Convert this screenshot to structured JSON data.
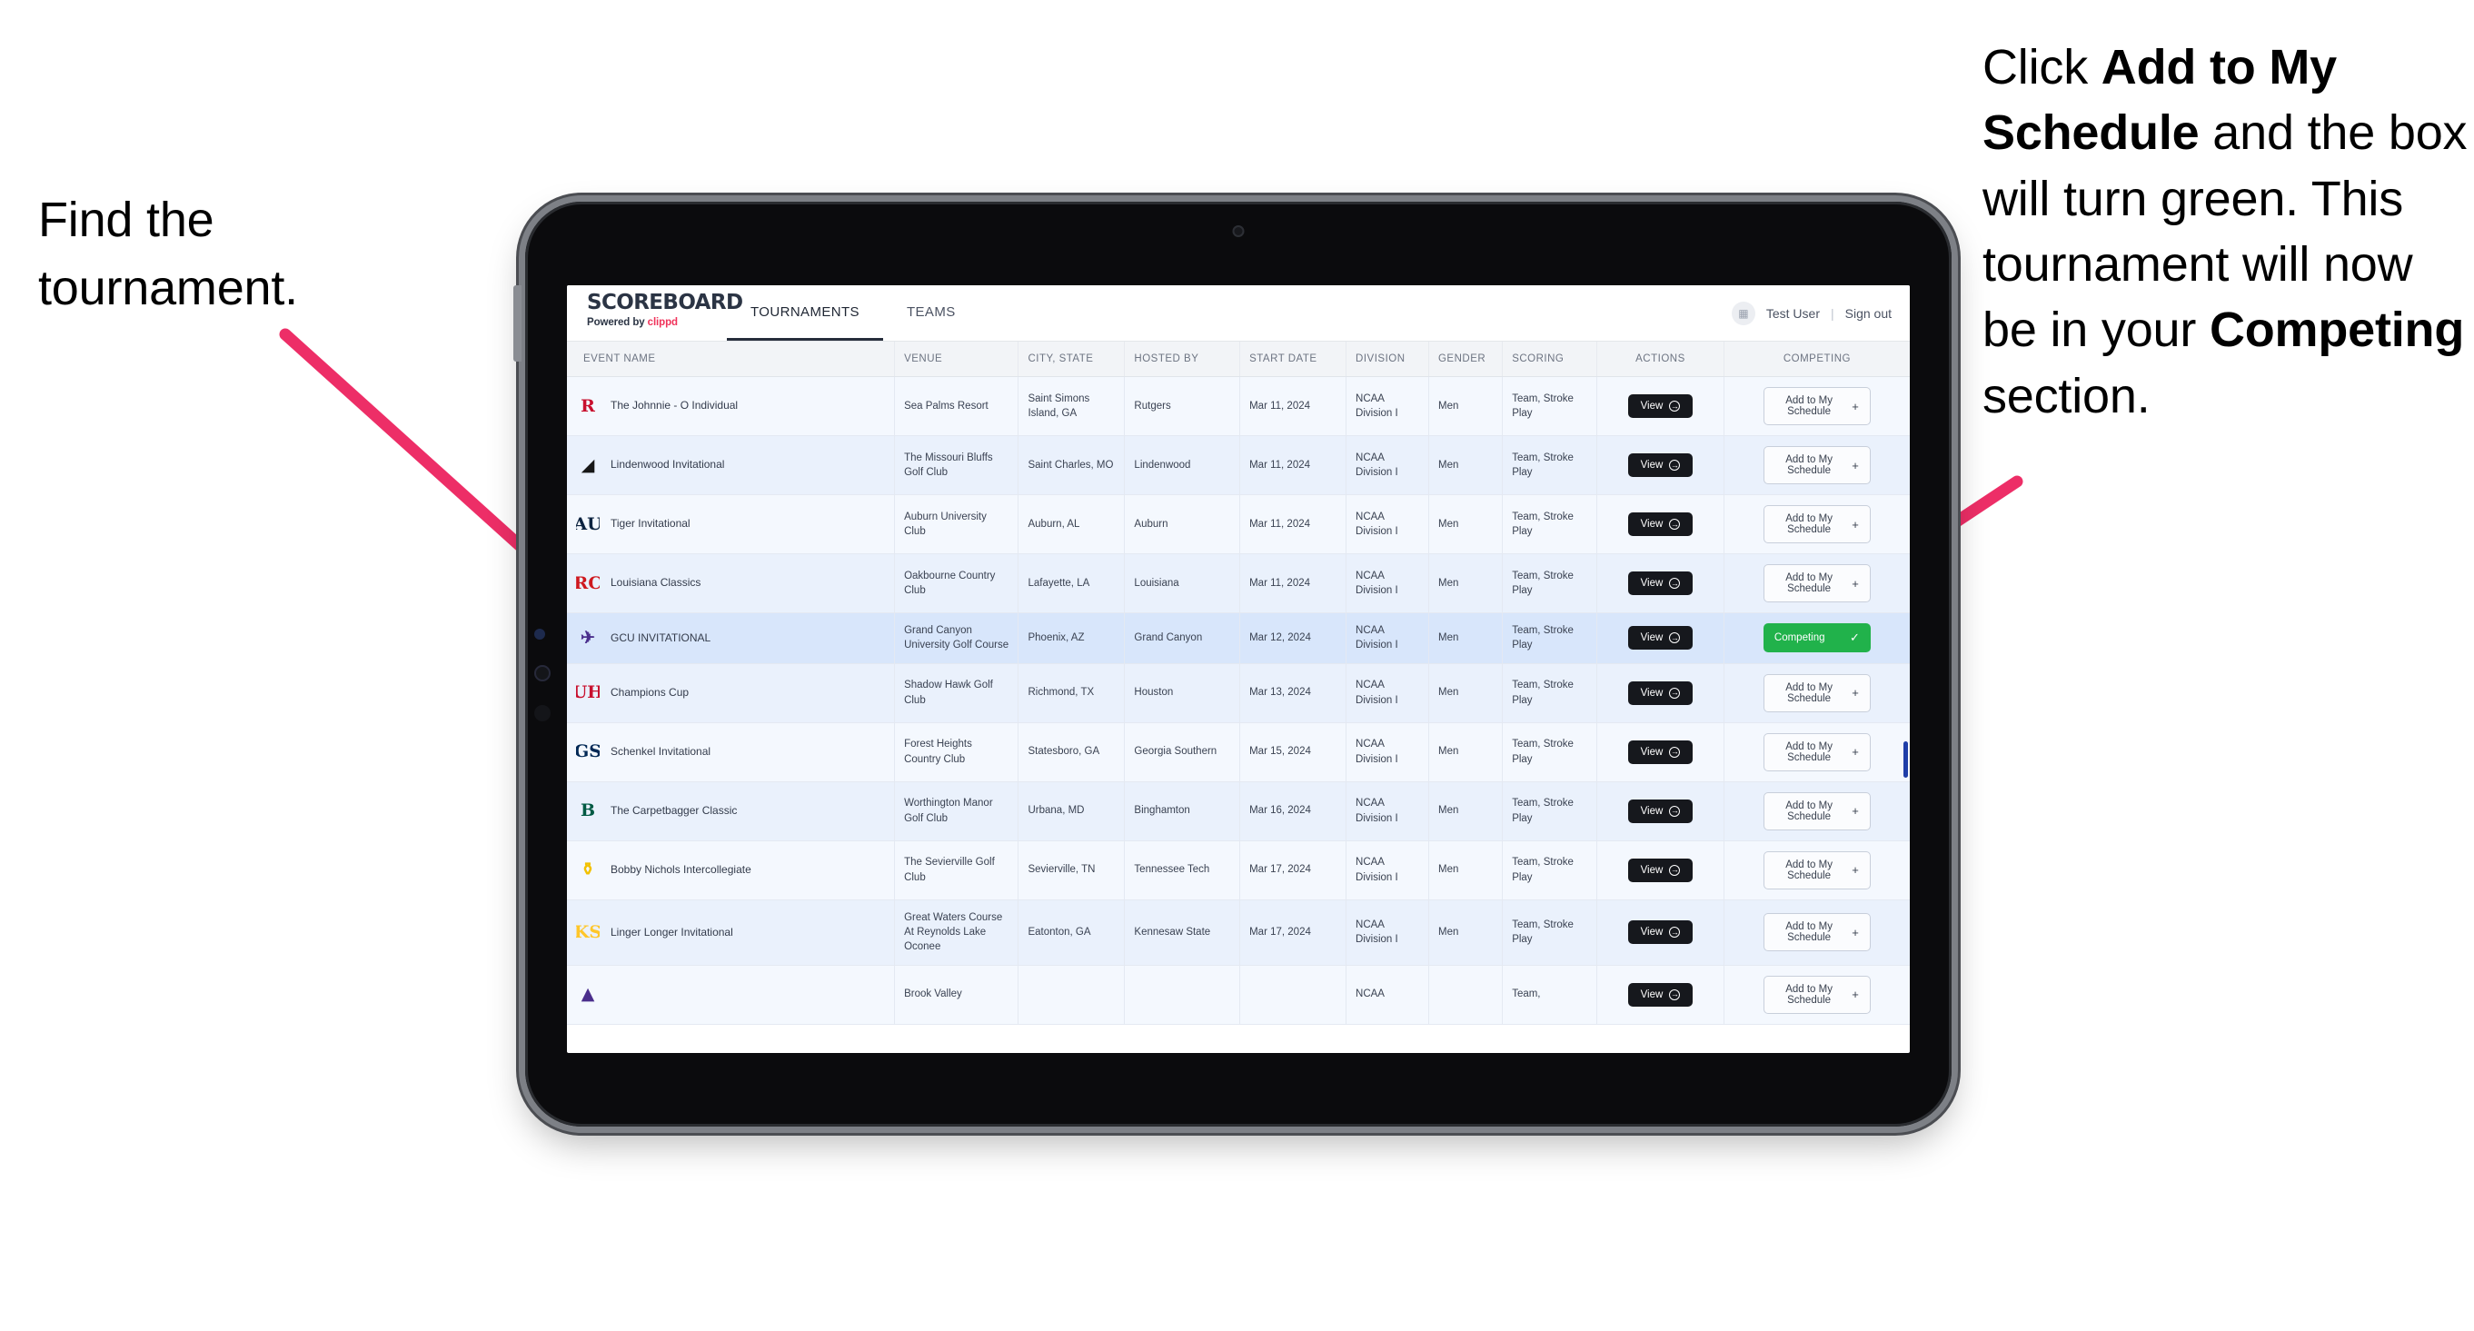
{
  "annotations": {
    "left": "Find the tournament.",
    "right_parts": [
      {
        "text": "Click ",
        "bold": false
      },
      {
        "text": "Add to My Schedule",
        "bold": true
      },
      {
        "text": " and the box will turn green. This tournament will now be in your ",
        "bold": false
      },
      {
        "text": "Competing",
        "bold": true
      },
      {
        "text": " section.",
        "bold": false
      }
    ],
    "arrow_color": "#ED2E67"
  },
  "app": {
    "brand": {
      "title": "SCOREBOARD",
      "powered_prefix": "Powered by ",
      "powered_brand": "clippd"
    },
    "tabs": [
      {
        "label": "TOURNAMENTS",
        "active": true
      },
      {
        "label": "TEAMS",
        "active": false
      }
    ],
    "header_right": {
      "avatar_glyph": "▦",
      "user": "Test User",
      "separator": "|",
      "signout": "Sign out"
    },
    "columns": [
      "EVENT NAME",
      "VENUE",
      "CITY, STATE",
      "HOSTED BY",
      "START DATE",
      "DIVISION",
      "GENDER",
      "SCORING",
      "ACTIONS",
      "COMPETING"
    ],
    "action_labels": {
      "view": "View",
      "view_icon": "arrow-right-circle-icon",
      "add": "Add to My Schedule",
      "add_icon": "plus-icon",
      "competing": "Competing",
      "competing_icon": "check-icon"
    },
    "rows": [
      {
        "logo_text": "R",
        "logo_color": "#C8102E",
        "logo_bg": "transparent",
        "event": "The Johnnie - O Individual",
        "venue": "Sea Palms Resort",
        "city": "Saint Simons Island, GA",
        "host": "Rutgers",
        "date": "Mar 11, 2024",
        "division": "NCAA Division I",
        "gender": "Men",
        "scoring": "Team, Stroke Play",
        "status": "add",
        "selected": false
      },
      {
        "logo_text": "◢",
        "logo_color": "#171717",
        "logo_bg": "transparent",
        "event": "Lindenwood Invitational",
        "venue": "The Missouri Bluffs Golf Club",
        "city": "Saint Charles, MO",
        "host": "Lindenwood",
        "date": "Mar 11, 2024",
        "division": "NCAA Division I",
        "gender": "Men",
        "scoring": "Team, Stroke Play",
        "status": "add",
        "selected": false
      },
      {
        "logo_text": "AU",
        "logo_color": "#0C2340",
        "logo_bg": "transparent",
        "event": "Tiger Invitational",
        "venue": "Auburn University Club",
        "city": "Auburn, AL",
        "host": "Auburn",
        "date": "Mar 11, 2024",
        "division": "NCAA Division I",
        "gender": "Men",
        "scoring": "Team, Stroke Play",
        "status": "add",
        "selected": false
      },
      {
        "logo_text": "RC",
        "logo_color": "#CE181E",
        "logo_bg": "transparent",
        "event": "Louisiana Classics",
        "venue": "Oakbourne Country Club",
        "city": "Lafayette, LA",
        "host": "Louisiana",
        "date": "Mar 11, 2024",
        "division": "NCAA Division I",
        "gender": "Men",
        "scoring": "Team, Stroke Play",
        "status": "add",
        "selected": false
      },
      {
        "logo_text": "✈",
        "logo_color": "#4A2E8C",
        "logo_bg": "transparent",
        "event": "GCU INVITATIONAL",
        "venue": "Grand Canyon University Golf Course",
        "city": "Phoenix, AZ",
        "host": "Grand Canyon",
        "date": "Mar 12, 2024",
        "division": "NCAA Division I",
        "gender": "Men",
        "scoring": "Team, Stroke Play",
        "status": "competing",
        "selected": true
      },
      {
        "logo_text": "UH",
        "logo_color": "#C8102E",
        "logo_bg": "transparent",
        "event": "Champions Cup",
        "venue": "Shadow Hawk Golf Club",
        "city": "Richmond, TX",
        "host": "Houston",
        "date": "Mar 13, 2024",
        "division": "NCAA Division I",
        "gender": "Men",
        "scoring": "Team, Stroke Play",
        "status": "add",
        "selected": false
      },
      {
        "logo_text": "GS",
        "logo_color": "#002855",
        "logo_bg": "transparent",
        "event": "Schenkel Invitational",
        "venue": "Forest Heights Country Club",
        "city": "Statesboro, GA",
        "host": "Georgia Southern",
        "date": "Mar 15, 2024",
        "division": "NCAA Division I",
        "gender": "Men",
        "scoring": "Team, Stroke Play",
        "status": "add",
        "selected": false
      },
      {
        "logo_text": "B",
        "logo_color": "#005A43",
        "logo_bg": "transparent",
        "event": "The Carpetbagger Classic",
        "venue": "Worthington Manor Golf Club",
        "city": "Urbana, MD",
        "host": "Binghamton",
        "date": "Mar 16, 2024",
        "division": "NCAA Division I",
        "gender": "Men",
        "scoring": "Team, Stroke Play",
        "status": "add",
        "selected": false
      },
      {
        "logo_text": "⚱",
        "logo_color": "#F2C100",
        "logo_bg": "transparent",
        "event": "Bobby Nichols Intercollegiate",
        "venue": "The Sevierville Golf Club",
        "city": "Sevierville, TN",
        "host": "Tennessee Tech",
        "date": "Mar 17, 2024",
        "division": "NCAA Division I",
        "gender": "Men",
        "scoring": "Team, Stroke Play",
        "status": "add",
        "selected": false
      },
      {
        "logo_text": "KS",
        "logo_color": "#FFC629",
        "logo_bg": "transparent",
        "event": "Linger Longer Invitational",
        "venue": "Great Waters Course At Reynolds Lake Oconee",
        "city": "Eatonton, GA",
        "host": "Kennesaw State",
        "date": "Mar 17, 2024",
        "division": "NCAA Division I",
        "gender": "Men",
        "scoring": "Team, Stroke Play",
        "status": "add",
        "selected": false
      },
      {
        "logo_text": "▲",
        "logo_color": "#4A2E8C",
        "logo_bg": "transparent",
        "event": "",
        "venue": "Brook Valley",
        "city": "",
        "host": "",
        "date": "",
        "division": "NCAA",
        "gender": "",
        "scoring": "Team,",
        "status": "add",
        "selected": false
      }
    ]
  }
}
